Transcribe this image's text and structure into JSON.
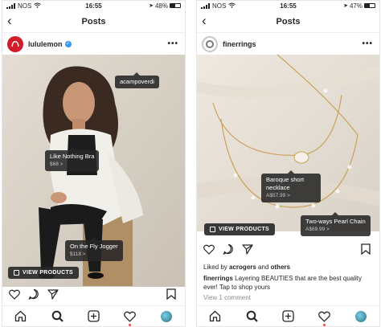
{
  "left": {
    "status": {
      "carrier": "NOS",
      "time": "16:55",
      "battery": "48%",
      "battery_level": 0.48
    },
    "nav": {
      "title": "Posts",
      "back": "<"
    },
    "post": {
      "username": "lululemon",
      "verified": true,
      "more": "•••",
      "tags": [
        {
          "label": "acampoverdi",
          "price": ""
        },
        {
          "label": "Like Nothing Bra",
          "price": "$68 >"
        },
        {
          "label": "On the Fly Jogger",
          "price": "$118 >"
        }
      ],
      "view_products": "VIEW PRODUCTS"
    }
  },
  "right": {
    "status": {
      "carrier": "NOS",
      "time": "16:55",
      "battery": "47%",
      "battery_level": 0.47
    },
    "nav": {
      "title": "Posts",
      "back": "<"
    },
    "post": {
      "username": "finerrings",
      "more": "•••",
      "tags": [
        {
          "label": "Baroque short necklace",
          "price": "A$57.99 >"
        },
        {
          "label": "Two-ways Pearl Chain",
          "price": "A$69.99 >"
        }
      ],
      "view_products": "VIEW PRODUCTS",
      "liked_prefix": "Liked by ",
      "liked_user": "acrogers",
      "liked_middle": " and ",
      "liked_others": "others",
      "caption_user": "finerrings",
      "caption_text": " Layering BEAUTIES that are the best quality ever! Tap to shop yours",
      "view_comment": "View 1 comment"
    }
  },
  "icons": [
    "back-icon",
    "more-icon",
    "heart-icon",
    "comment-icon",
    "share-icon",
    "bookmark-icon",
    "home-icon",
    "search-icon",
    "add-icon",
    "activity-icon",
    "profile-icon",
    "shopping-bag-icon",
    "wifi-icon",
    "signal-icon",
    "battery-icon"
  ],
  "colors": {
    "verified": "#3897f0",
    "notification": "#ed4956",
    "tag_bg": "#262626",
    "lululemon": "#d31c2a"
  }
}
